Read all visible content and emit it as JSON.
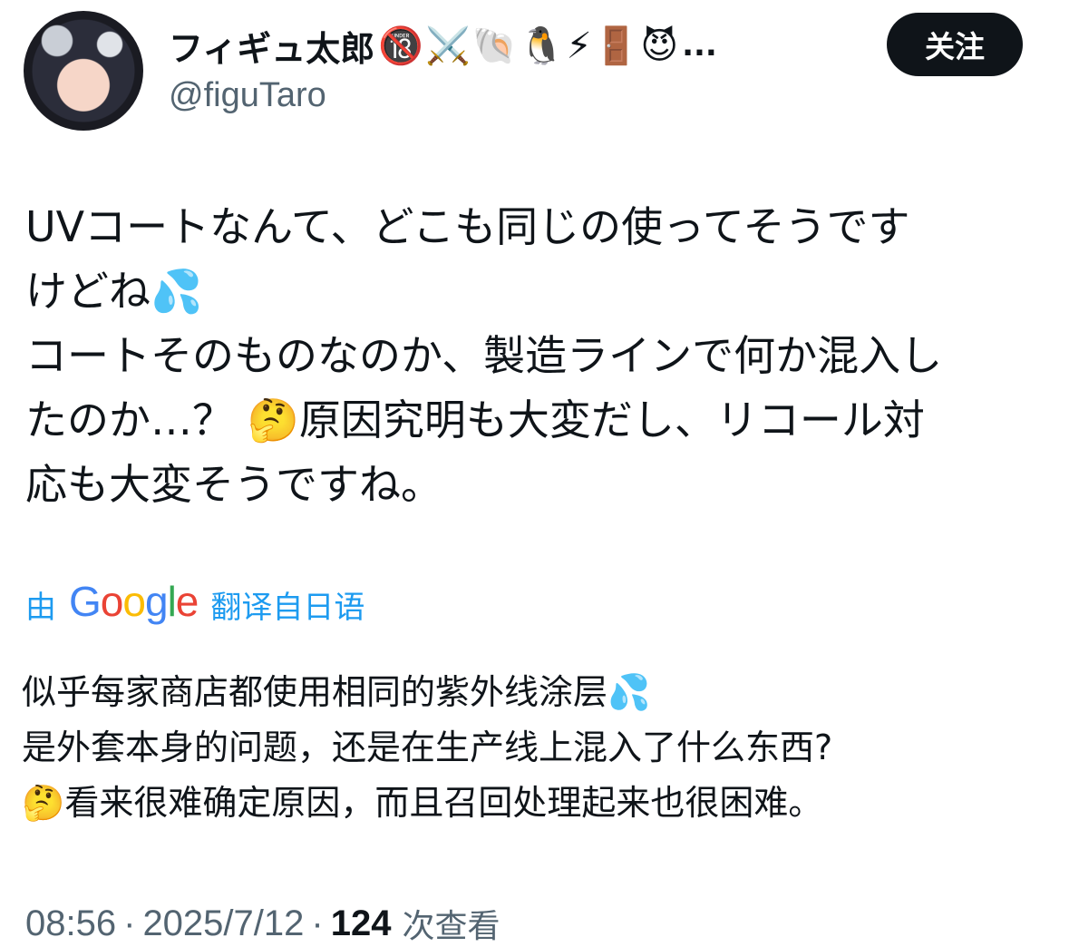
{
  "author": {
    "display_name": "フィギュ太郎",
    "badges": "🔞⚔️🐚🐧⚡🚪😈",
    "name_truncation": "...",
    "handle": "@figuTaro"
  },
  "follow_button": {
    "label": "关注"
  },
  "tweet": {
    "text": "UVコートなんて、どこも同じの使ってそうです\nけどね💦\nコートそのものなのか、製造ラインで何か混入し\nたのか…？ 🤔原因究明も大変だし、リコール対\n応も大変そうですね。"
  },
  "translation": {
    "prefix": "由",
    "logo_letters": [
      "G",
      "o",
      "o",
      "g",
      "l",
      "e"
    ],
    "suffix": "翻译自日语",
    "text": "似乎每家商店都使用相同的紫外线涂层💦\n是外套本身的问题，还是在生产线上混入了什么东西?\n🤔看来很难确定原因，而且召回处理起来也很困难。"
  },
  "meta": {
    "time": "08:56",
    "separator": "·",
    "date": "2025/7/12",
    "views_count": "124",
    "views_label": "次查看"
  },
  "colors": {
    "text": "#0f1419",
    "secondary": "#536471",
    "link": "#1d9bf0",
    "button_bg": "#0f1419",
    "button_text": "#ffffff"
  }
}
